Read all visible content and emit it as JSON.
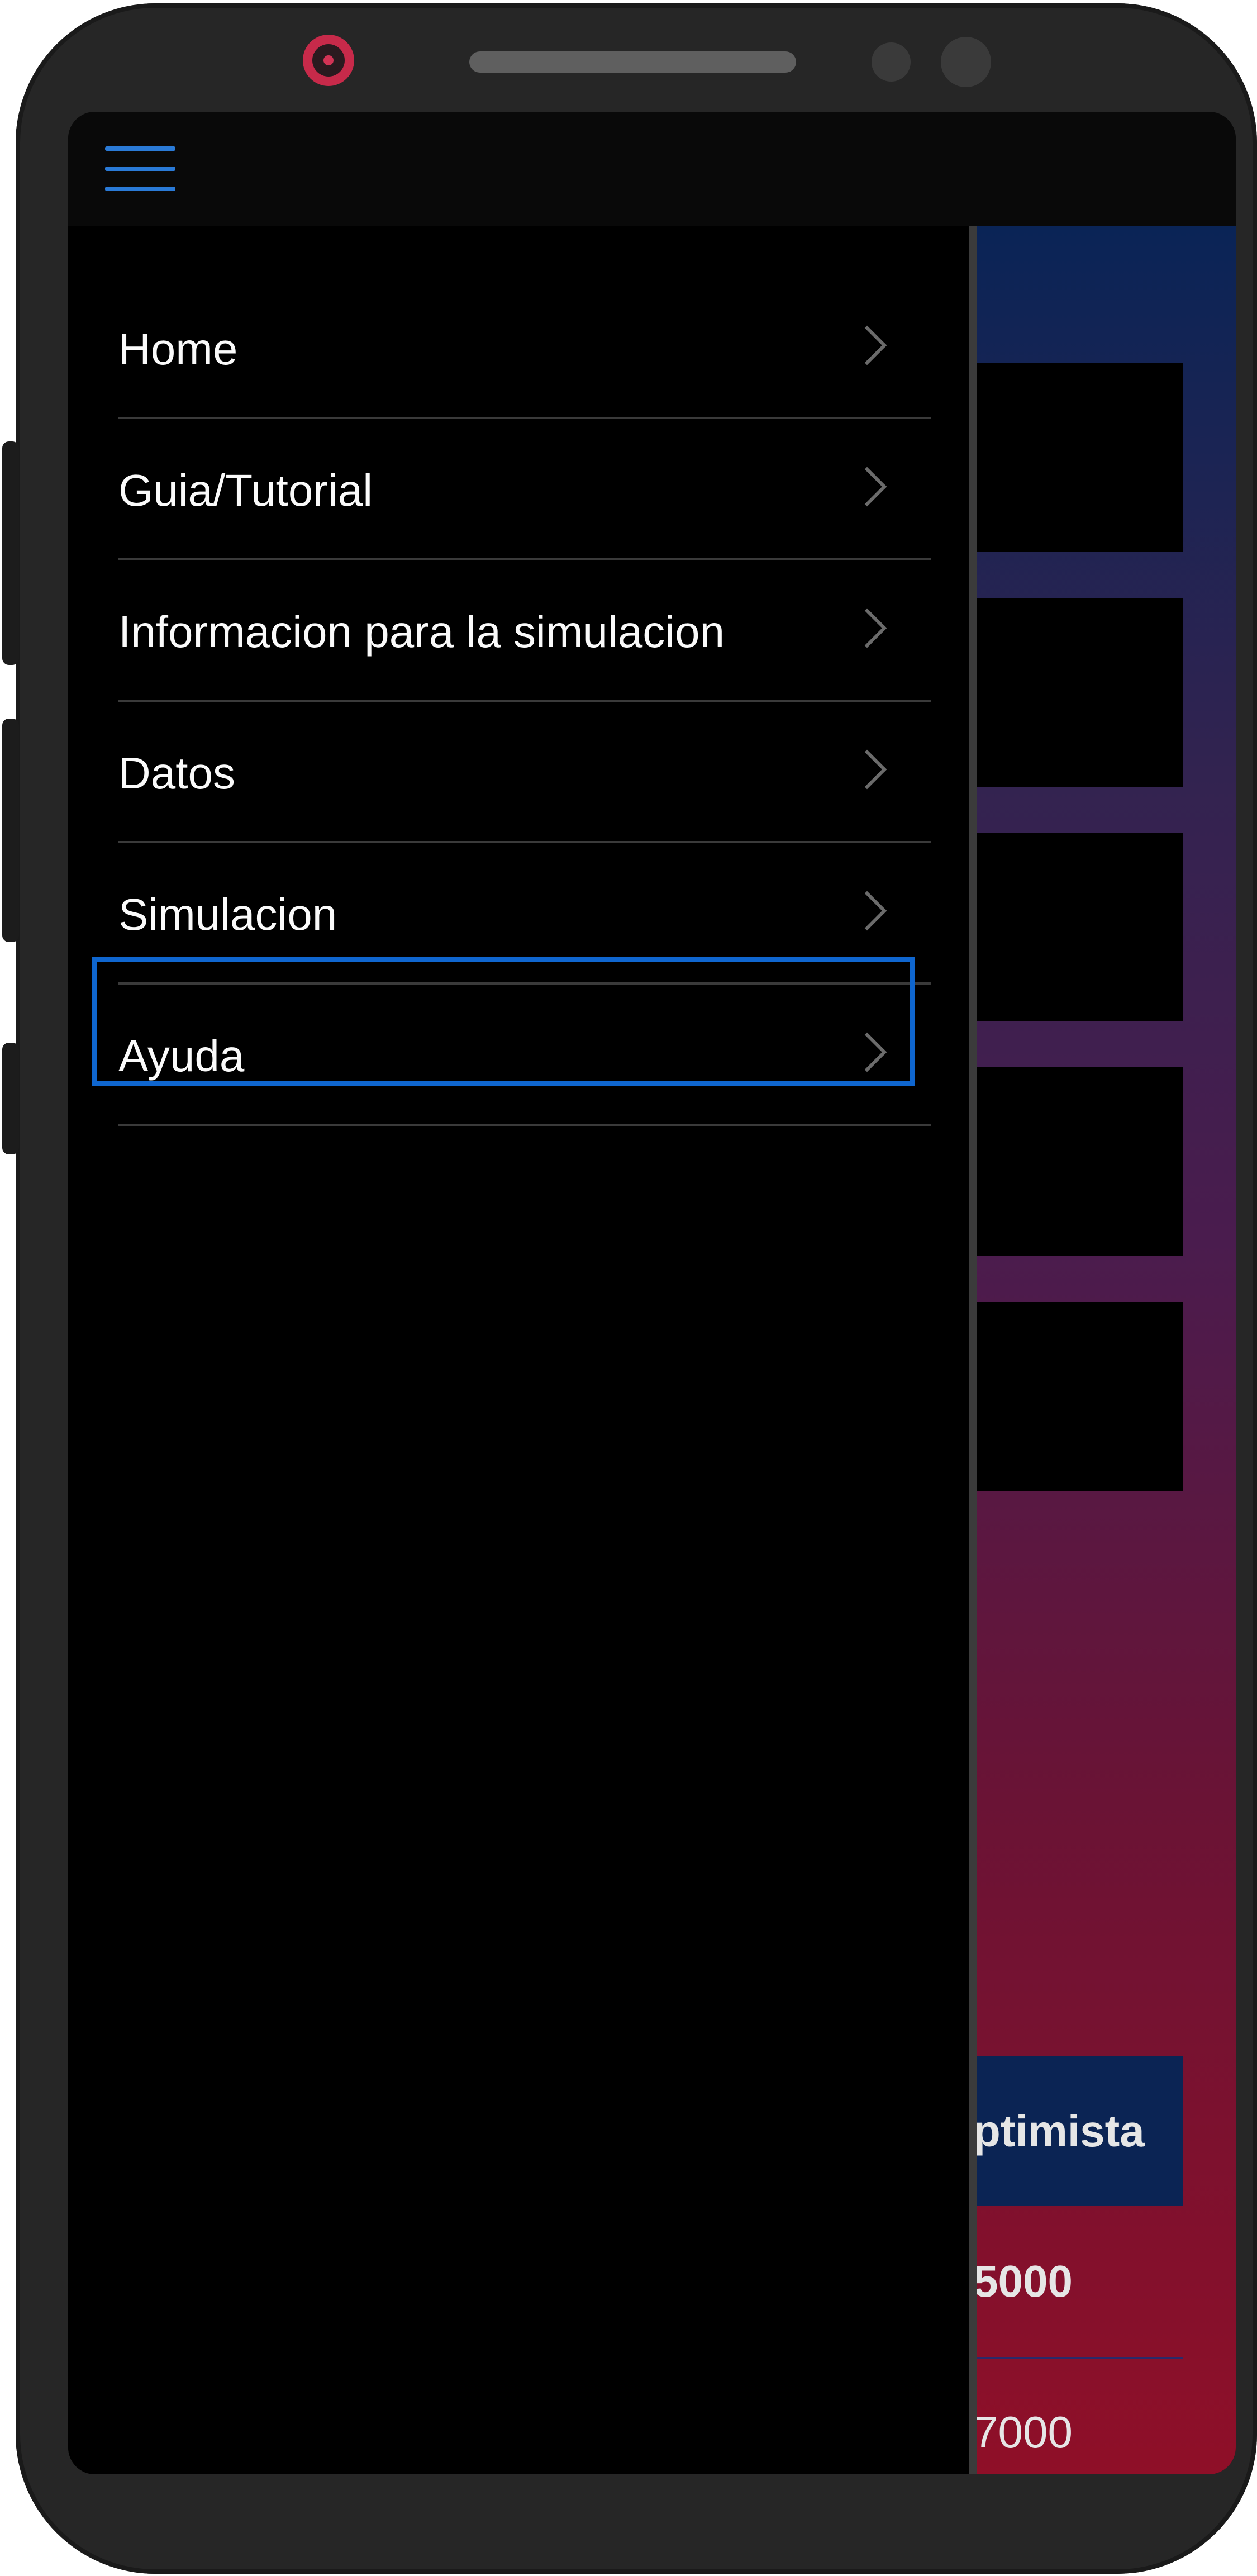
{
  "menu": {
    "items": [
      {
        "label": "Home"
      },
      {
        "label": "Guia/Tutorial"
      },
      {
        "label": "Informacion para la simulacion"
      },
      {
        "label": "Datos"
      },
      {
        "label": "Simulacion",
        "selected": true
      },
      {
        "label": "Ayuda"
      }
    ]
  },
  "background": {
    "table_header": "ptimista",
    "row1": "5000",
    "row2": "7000"
  },
  "colors": {
    "accent": "#0f66cf",
    "hamburger": "#2a7ad6",
    "drawer_bg": "#000000",
    "text": "#fafafa"
  },
  "icons": [
    "menu-icon",
    "chevron-right-icon"
  ]
}
